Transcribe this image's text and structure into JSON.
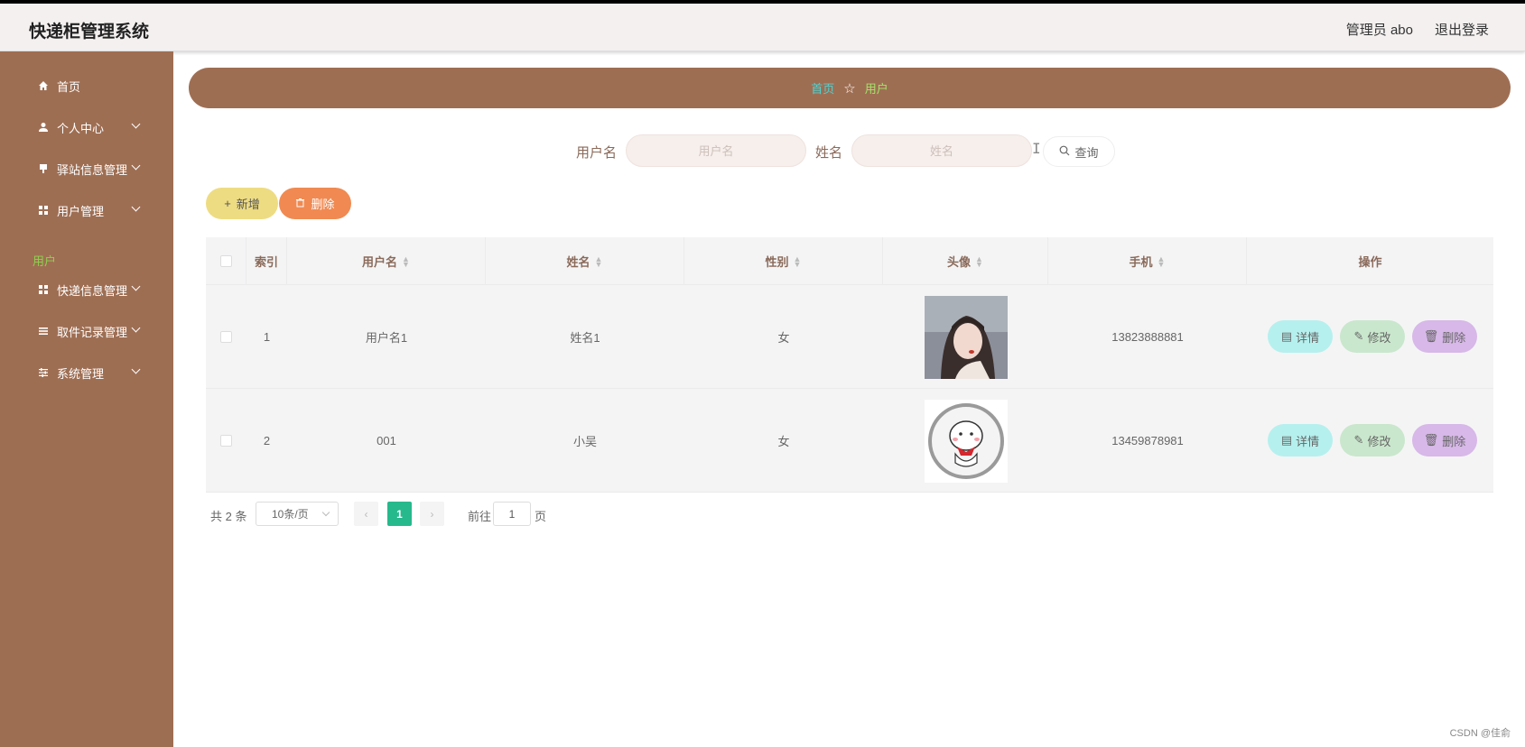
{
  "header": {
    "title": "快递柜管理系统",
    "user": "管理员 abo",
    "logout": "退出登录"
  },
  "sidebar": {
    "items": [
      {
        "label": "首页",
        "icon": "home-icon"
      },
      {
        "label": "个人中心",
        "icon": "user-icon"
      },
      {
        "label": "驿站信息管理",
        "icon": "station-icon"
      },
      {
        "label": "用户管理",
        "icon": "grid-icon"
      },
      {
        "label": "快递信息管理",
        "icon": "grid-icon"
      },
      {
        "label": "取件记录管理",
        "icon": "list-icon"
      },
      {
        "label": "系统管理",
        "icon": "sliders-icon"
      }
    ],
    "active_sub": "用户"
  },
  "breadcrumb": {
    "home": "首页",
    "current": "用户"
  },
  "search": {
    "username_label": "用户名",
    "username_placeholder": "用户名",
    "name_label": "姓名",
    "name_placeholder": "姓名",
    "button": "查询"
  },
  "actions": {
    "add": "新增",
    "delete": "删除"
  },
  "table": {
    "columns": [
      "索引",
      "用户名",
      "姓名",
      "性别",
      "头像",
      "手机",
      "操作"
    ],
    "rows": [
      {
        "index": "1",
        "username": "用户名1",
        "name": "姓名1",
        "gender": "女",
        "phone": "13823888881"
      },
      {
        "index": "2",
        "username": "001",
        "name": "小吴",
        "gender": "女",
        "phone": "13459878981"
      }
    ],
    "ops": {
      "detail": "详情",
      "edit": "修改",
      "delete": "删除"
    }
  },
  "pagination": {
    "total": "共 2 条",
    "page_size": "10条/页",
    "current_page": "1",
    "goto_label": "前往",
    "goto_value": "1",
    "page_unit": "页"
  },
  "watermark": "CSDN @佳俞",
  "colors": {
    "sidebar": "#9e6e53",
    "active_green": "#8fd14f",
    "page_active": "#26b98c"
  }
}
